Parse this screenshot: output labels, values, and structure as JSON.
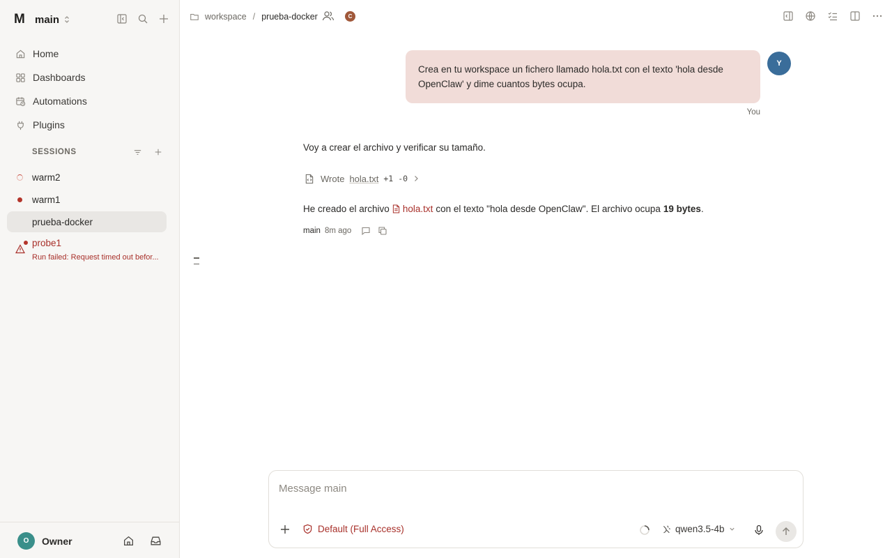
{
  "workspace": {
    "logo": "M",
    "name": "main"
  },
  "nav": [
    {
      "label": "Home",
      "icon": "home-icon"
    },
    {
      "label": "Dashboards",
      "icon": "dashboards-icon"
    },
    {
      "label": "Automations",
      "icon": "automations-icon"
    },
    {
      "label": "Plugins",
      "icon": "plug-icon"
    }
  ],
  "sessions": {
    "title": "SESSIONS",
    "items": [
      {
        "name": "warm2",
        "status": "loading"
      },
      {
        "name": "warm1",
        "status": "active"
      },
      {
        "name": "prueba-docker",
        "status": "selected"
      }
    ],
    "failed": {
      "name": "probe1",
      "error": "Run failed: Request timed out befor..."
    }
  },
  "footer": {
    "avatar_initial": "O",
    "user": "Owner"
  },
  "breadcrumb": {
    "root": "workspace",
    "separator": "/",
    "current": "prueba-docker",
    "collaborator_initial": "C"
  },
  "chat": {
    "user_avatar": "Y",
    "user_message": "Crea en tu workspace un fichero llamado hola.txt con el texto 'hola desde OpenClaw' y dime cuantos bytes ocupa.",
    "user_label": "You",
    "assistant_intro": "Voy a crear el archivo y verificar su tamaño.",
    "tool": {
      "action": "Wrote",
      "file": "hola.txt",
      "added": "+1",
      "removed": "-0"
    },
    "final_before": "He creado el archivo",
    "final_file": "hola.txt",
    "final_middle": "con el texto \"hola desde OpenClaw\". El archivo ocupa",
    "final_bold": "19 bytes",
    "final_end": ".",
    "meta_agent": "main",
    "meta_time": "8m ago"
  },
  "composer": {
    "placeholder": "Message main",
    "access_label": "Default (Full Access)",
    "model": "qwen3.5-4b"
  },
  "colors": {
    "accent_red": "#a8302a",
    "user_bubble": "#f1dcd8",
    "user_avatar": "#3a6d9a",
    "owner_avatar": "#3a8f8a"
  }
}
